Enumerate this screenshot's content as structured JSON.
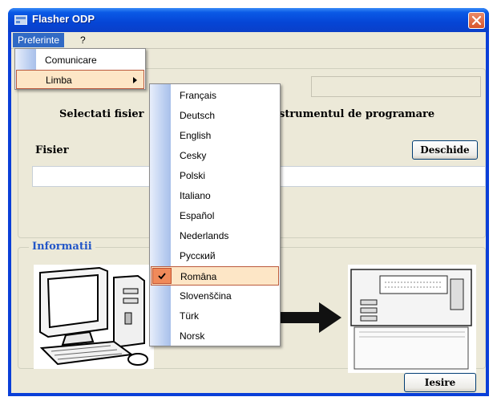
{
  "window": {
    "title": "Flasher ODP"
  },
  "menubar": {
    "items": [
      {
        "label": "Preferinte"
      },
      {
        "label": "?"
      }
    ]
  },
  "preferinte_menu": {
    "items": [
      {
        "label": "Comunicare"
      },
      {
        "label": "Limba"
      }
    ]
  },
  "language_menu": {
    "items": [
      {
        "label": "Français"
      },
      {
        "label": "Deutsch"
      },
      {
        "label": "English"
      },
      {
        "label": "Cesky"
      },
      {
        "label": "Polski"
      },
      {
        "label": "Italiano"
      },
      {
        "label": "Español"
      },
      {
        "label": "Nederlands"
      },
      {
        "label": "Русский"
      },
      {
        "label": "Româna",
        "checked": true
      },
      {
        "label": "Slovenščina"
      },
      {
        "label": "Türk"
      },
      {
        "label": "Norsk"
      }
    ]
  },
  "main": {
    "instruction_left": "Selectati fisier",
    "instruction_right": "strumentul de programare",
    "file_label": "Fisier",
    "file_value": "",
    "open_button": "Deschide"
  },
  "info": {
    "label": "Informatii"
  },
  "footer": {
    "exit_button": "Iesire"
  },
  "colors": {
    "titlebar": "#0545d6",
    "highlight": "#fde6c6",
    "menu_active": "#316ac5"
  }
}
